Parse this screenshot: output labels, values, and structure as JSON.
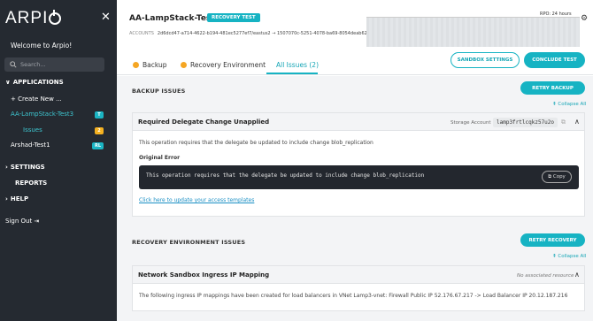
{
  "sidebar": {
    "logo": "ARPIO",
    "welcome": "Welcome to Arpio!",
    "search_placeholder": "Search...",
    "applications_label": "APPLICATIONS",
    "create_new": "+ Create New ...",
    "apps": [
      {
        "name": "AA-LampStack-Test3",
        "badge": "T"
      },
      {
        "name": "Issues",
        "badge": "2"
      },
      {
        "name": "Arshad-Test1",
        "badge": "RL"
      }
    ],
    "settings_label": "SETTINGS",
    "reports_label": "REPORTS",
    "help_label": "HELP",
    "sign_out": "Sign Out"
  },
  "header": {
    "title": "AA-LampStack-Test3",
    "recovery_badge": "RECOVERY TEST",
    "accounts_label": "ACCOUNTS",
    "accounts_value": "2d6dcd47-a714-4622-b194-481ec5277ef7/eastus2 → 1507070c-5251-4078-ba69-8054deab62...",
    "rpo": "RPO: 24 hours"
  },
  "tabs": [
    {
      "label": "Backup"
    },
    {
      "label": "Recovery Environment"
    },
    {
      "label": "All Issues (2)"
    }
  ],
  "buttons": {
    "sandbox_settings": "SANDBOX SETTINGS",
    "conclude_test": "CONCLUDE TEST",
    "retry_backup": "RETRY BACKUP",
    "retry_recovery": "RETRY RECOVERY",
    "copy": "Copy"
  },
  "backup_section": {
    "title": "BACKUP ISSUES",
    "collapse": "Collapse All",
    "card_title": "Required Delegate Change Unapplied",
    "storage_label": "Storage Account",
    "storage_value": "lamp3frtlcqkz57u2o",
    "description": "This operation requires that the delegate be updated to include change blob_replication",
    "original_error_label": "Original Error",
    "error_text": "This operation requires that the delegate be updated to include change blob_replication",
    "link": "Click here to update your access templates"
  },
  "recovery_section": {
    "title": "RECOVERY ENVIRONMENT ISSUES",
    "collapse": "Collapse All",
    "card_title": "Network Sandbox Ingress IP Mapping",
    "no_resource": "No associated resource",
    "description": "The following ingress IP mappings have been created for load balancers in VNet Lamp3-vnet: Firewall Public IP 52.176.67.217 -> Load Balancer IP 20.12.187.216"
  },
  "colors": {
    "accent": "#16b3c3",
    "sidebar_bg": "#252a31",
    "warning": "#f5a623"
  }
}
